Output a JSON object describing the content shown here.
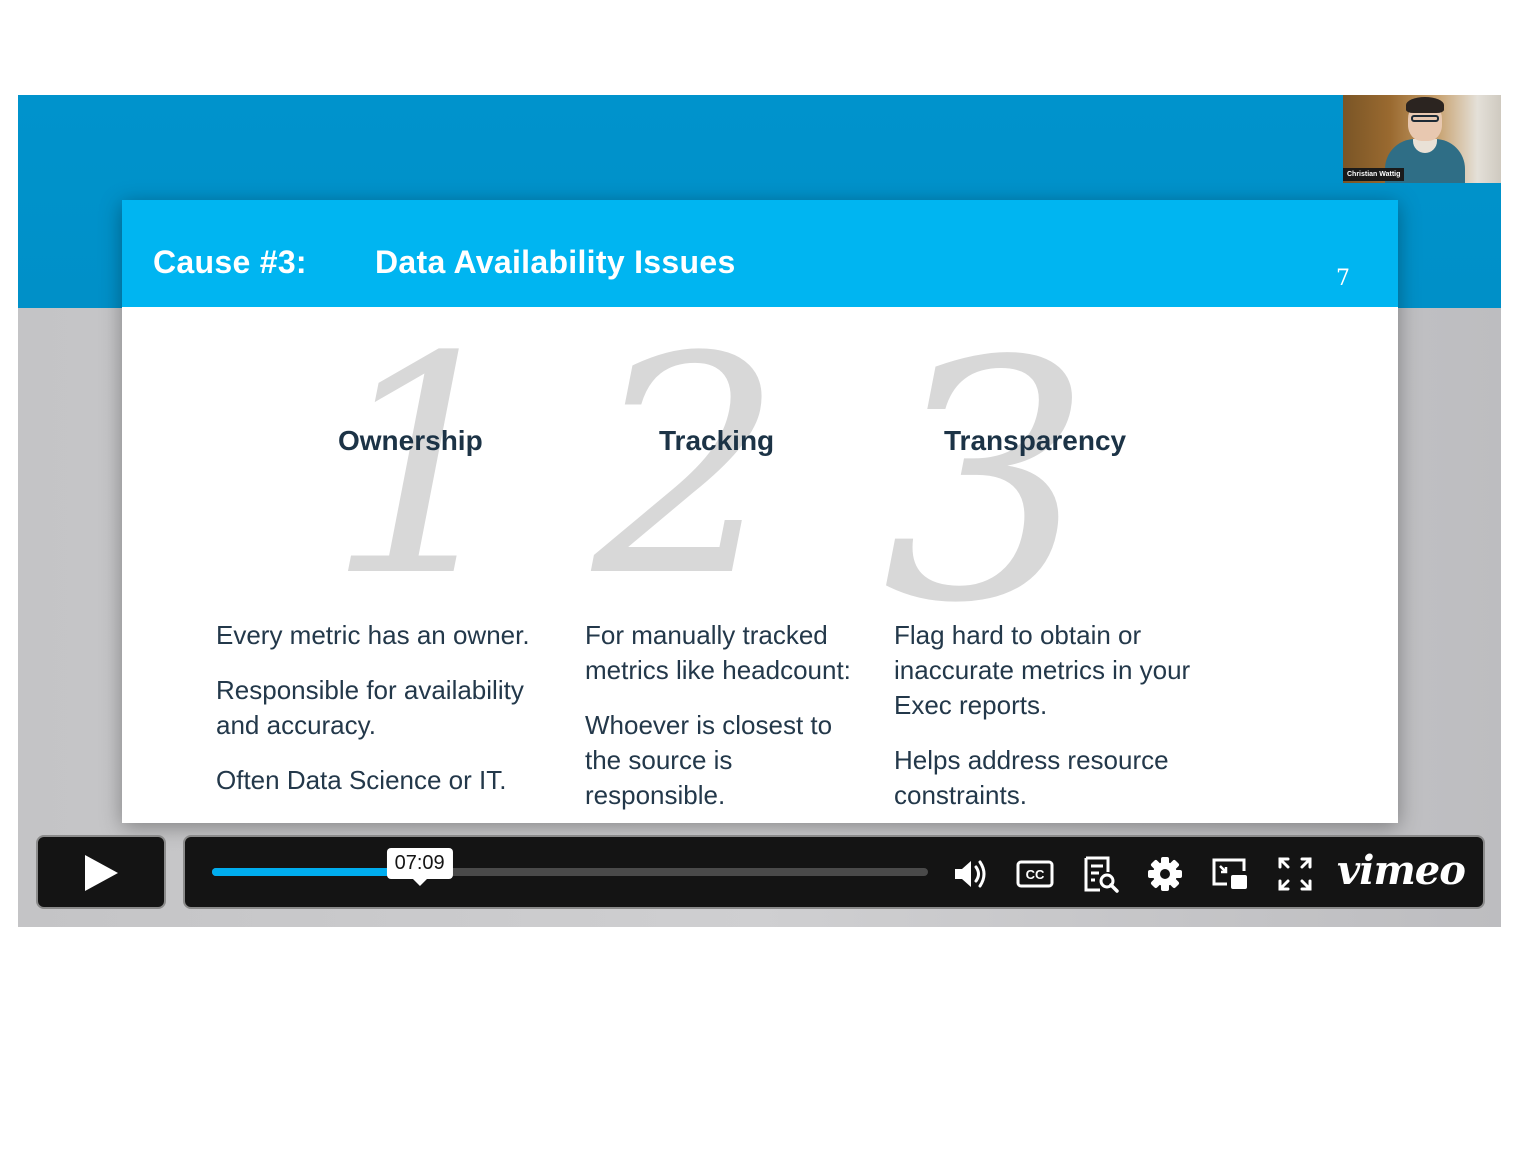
{
  "webcam": {
    "presenter_name": "Christian Wattig"
  },
  "slide": {
    "cause_label": "Cause #3:",
    "title": "Data Availability Issues",
    "page_number": "7",
    "columns": [
      {
        "number": "1",
        "heading": "Ownership",
        "paragraphs": [
          "Every metric has an owner.",
          "Responsible for availability and accuracy.",
          "Often Data Science or IT."
        ]
      },
      {
        "number": "2",
        "heading": "Tracking",
        "paragraphs": [
          "For manually tracked metrics like headcount:",
          "Whoever is closest to the source is responsible."
        ]
      },
      {
        "number": "3",
        "heading": "Transparency",
        "paragraphs": [
          "Flag hard to obtain or inaccurate metrics in your Exec reports.",
          "Helps address resource constraints."
        ]
      }
    ],
    "colors": {
      "header": "#00b5f1",
      "heading_text": "#1c3346",
      "body_text": "#23384a",
      "big_number": "#d8d8d8"
    }
  },
  "player": {
    "play_icon": "play-icon",
    "progress_percent": 29,
    "buffered_percent": 31,
    "hover_time": "07:09",
    "accent_color": "#00adef",
    "controls": [
      {
        "name": "volume",
        "icon": "volume-icon"
      },
      {
        "name": "captions",
        "icon": "cc-icon"
      },
      {
        "name": "transcript",
        "icon": "transcript-search-icon"
      },
      {
        "name": "settings",
        "icon": "gear-icon"
      },
      {
        "name": "picture-in-picture",
        "icon": "pip-icon"
      },
      {
        "name": "fullscreen",
        "icon": "fullscreen-icon"
      }
    ],
    "brand": "vimeo"
  }
}
